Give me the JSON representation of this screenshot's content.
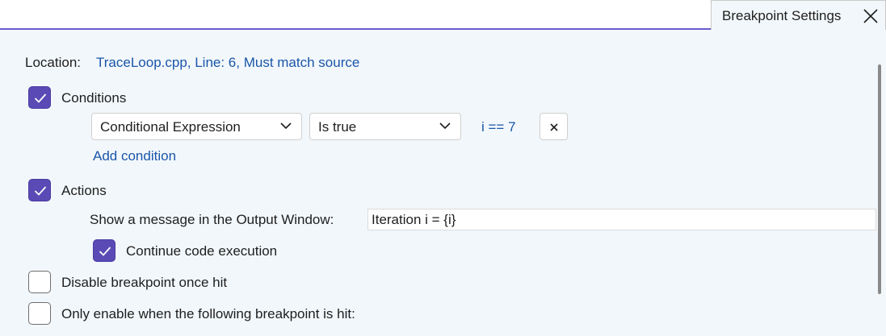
{
  "tab": {
    "title": "Breakpoint Settings",
    "close_icon": "close-icon"
  },
  "location": {
    "label": "Location:",
    "value": "TraceLoop.cpp, Line: 6, Must match source"
  },
  "conditions": {
    "label": "Conditions",
    "checked": true,
    "type_select": "Conditional Expression",
    "operator_select": "Is true",
    "expression": "i == 7",
    "add_label": "Add condition"
  },
  "actions": {
    "label": "Actions",
    "checked": true,
    "message_label": "Show a message in the Output Window:",
    "message_value": "Iteration i = {i}",
    "continue_label": "Continue code execution",
    "continue_checked": true
  },
  "options": {
    "disable_label": "Disable breakpoint once hit",
    "disable_checked": false,
    "dependent_label": "Only enable when the following breakpoint is hit:",
    "dependent_checked": false
  },
  "colors": {
    "accent": "#5a4ab5",
    "link": "#1a56a8",
    "panel_bg": "#f2f7fb"
  }
}
